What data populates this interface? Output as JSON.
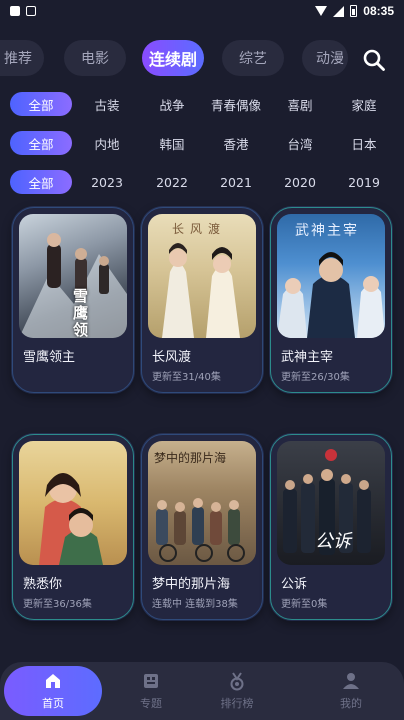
{
  "status_bar": {
    "time": "08:35"
  },
  "top_tabs": [
    {
      "label": "推荐",
      "active": false
    },
    {
      "label": "电影",
      "active": false
    },
    {
      "label": "连续剧",
      "active": true
    },
    {
      "label": "综艺",
      "active": false
    },
    {
      "label": "动漫",
      "active": false
    }
  ],
  "filters": {
    "genre": {
      "selected": "全部",
      "options": [
        "古装",
        "战争",
        "青春偶像",
        "喜剧",
        "家庭"
      ]
    },
    "region": {
      "selected": "全部",
      "options": [
        "内地",
        "韩国",
        "香港",
        "台湾",
        "日本"
      ]
    },
    "year": {
      "selected": "全部",
      "options": [
        "2023",
        "2022",
        "2021",
        "2020",
        "2019"
      ]
    }
  },
  "cards": [
    {
      "title": "雪鹰领主",
      "sub": "",
      "poster_text": "雪鹰领主"
    },
    {
      "title": "长风渡",
      "sub": "更新至31/40集",
      "poster_text": "长风渡"
    },
    {
      "title": "武神主宰",
      "sub": "更新至26/30集",
      "poster_text": "武神主宰"
    },
    {
      "title": "熟悉你",
      "sub": "更新至36/36集",
      "poster_text": ""
    },
    {
      "title": "梦中的那片海",
      "sub": "连载中 连载到38集",
      "poster_text": "梦中的那片海"
    },
    {
      "title": "公诉",
      "sub": "更新至0集",
      "poster_text": "公诉"
    }
  ],
  "bottom_nav": [
    {
      "label": "首页",
      "icon": "home-icon",
      "active": true
    },
    {
      "label": "专题",
      "icon": "topic-icon",
      "active": false
    },
    {
      "label": "排行榜",
      "icon": "medal-icon",
      "active": false
    },
    {
      "label": "我的",
      "icon": "user-icon",
      "active": false
    }
  ],
  "colors": {
    "background": "#1b1d2e",
    "accent_start": "#8a4cff",
    "accent_end": "#5b6cff",
    "nav_bg": "#2a2c3f"
  }
}
